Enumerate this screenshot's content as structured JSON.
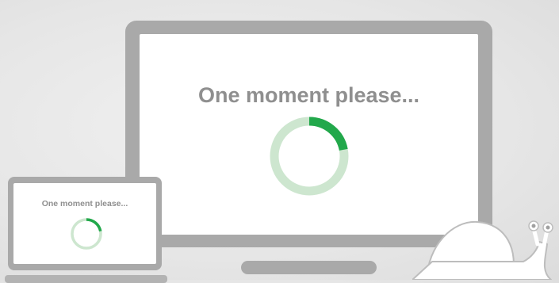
{
  "monitor": {
    "message": "One moment please...",
    "spinner": {
      "progress": 0.22,
      "track_color": "#cde6cf",
      "fill_color": "#22a84b"
    }
  },
  "laptop": {
    "message": "One moment please...",
    "spinner": {
      "progress": 0.22,
      "track_color": "#cde6cf",
      "fill_color": "#22a84b"
    }
  },
  "decor": {
    "snail_icon": "snail-icon",
    "device_color": "#a9a9a9"
  }
}
